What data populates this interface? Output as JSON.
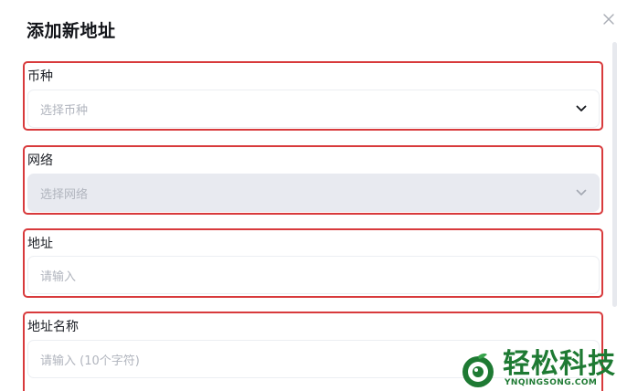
{
  "dialog": {
    "title": "添加新地址",
    "close_icon": "close-icon"
  },
  "fields": {
    "currency": {
      "label": "币种",
      "placeholder": "选择币种",
      "icon": "chevron-down-icon"
    },
    "network": {
      "label": "网络",
      "placeholder": "选择网络",
      "icon": "chevron-down-icon",
      "disabled": true
    },
    "address": {
      "label": "地址",
      "placeholder": "请输入"
    },
    "address_name": {
      "label": "地址名称",
      "placeholder": "请输入 (10个字符)"
    }
  },
  "watermark": {
    "text": "轻松科技",
    "subtext": "YNQINGSONG.COM"
  },
  "colors": {
    "highlight_border": "#d83a3c",
    "disabled_bg": "#e8eaf0",
    "watermark": "#1e7a33"
  }
}
